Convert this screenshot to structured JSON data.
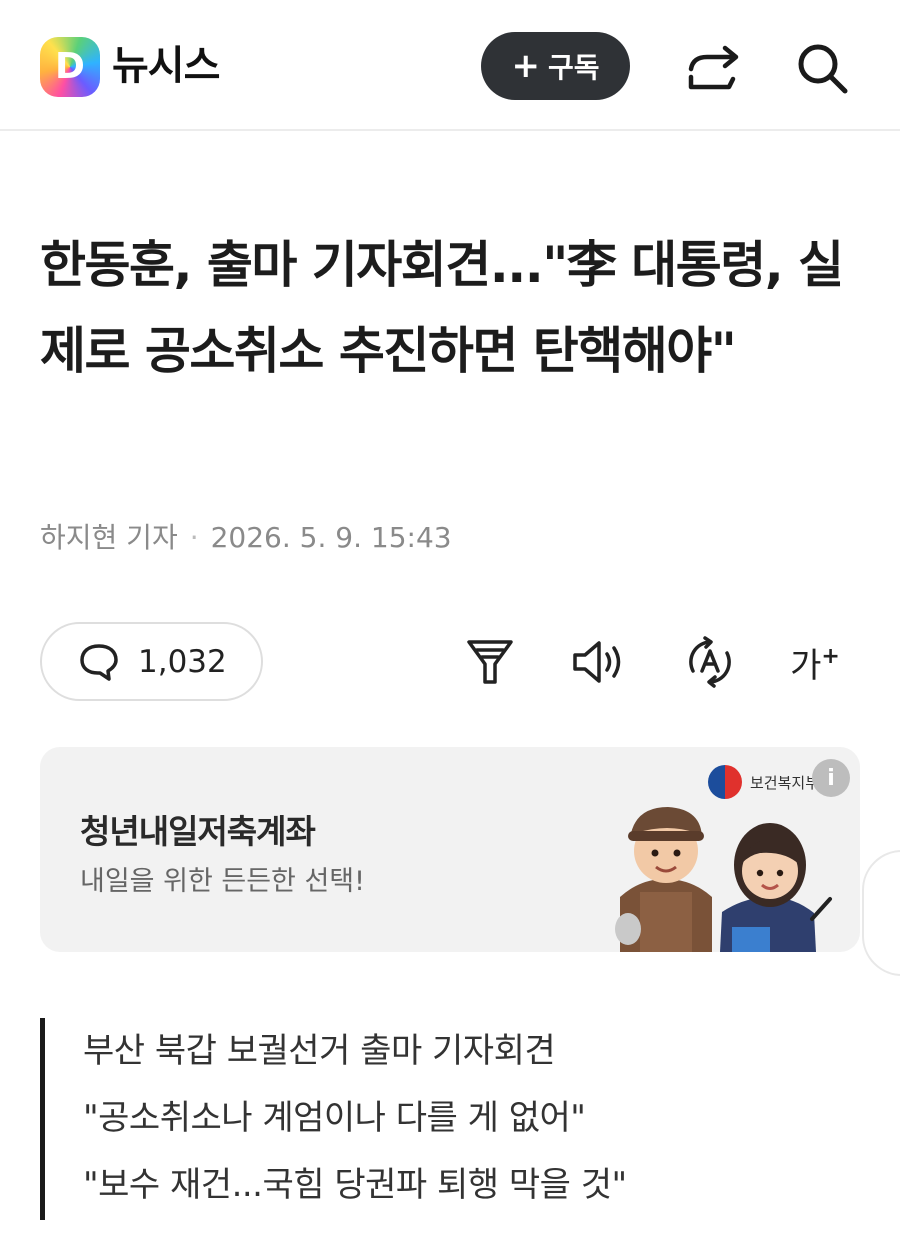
{
  "header": {
    "logo_letter": "D",
    "press_name": "뉴시스",
    "subscribe_plus": "+",
    "subscribe_label": "구독"
  },
  "article": {
    "headline": "한동훈, 출마 기자회견...\"李 대통령, 실제로 공소취소 추진하면 탄핵해야\"",
    "reporter": "하지현 기자",
    "separator": "·",
    "datetime": "2026. 5. 9. 15:43"
  },
  "toolbar": {
    "comment_count": "1,032",
    "font_label": "가",
    "font_plus": "+"
  },
  "ad": {
    "title": "청년내일저축계좌",
    "subtitle": "내일을 위한 든든한 선택!",
    "sponsor": "보건복지부",
    "info_glyph": "i"
  },
  "summary": [
    "부산 북갑 보궐선거 출마 기자회견",
    "\"공소취소나 계엄이나 다를 게 없어\"",
    "\"보수 재건...국힘 당권파 퇴행 막을 것\""
  ],
  "colors": {
    "subscribe_bg": "#2f3236",
    "text_primary": "#1c1c1c",
    "text_meta": "#8a8a8a",
    "ad_bg": "#f2f2f2"
  }
}
